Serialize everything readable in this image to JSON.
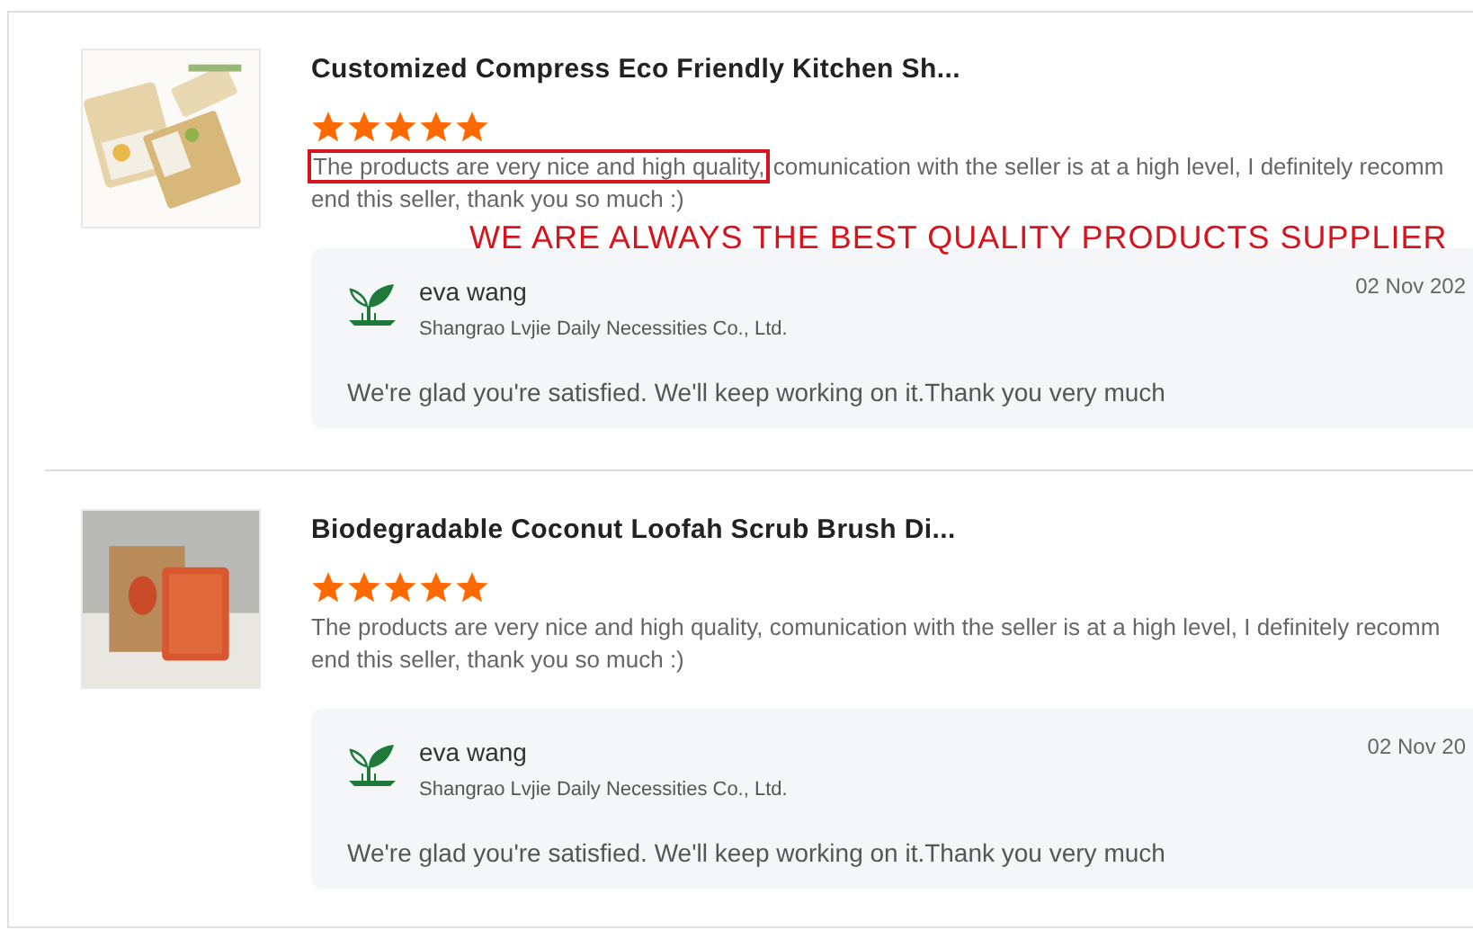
{
  "reviews": [
    {
      "kind": "picture",
      "title": "Customized Compress Eco Friendly Kitchen Sh...",
      "stars": 5,
      "comment": [
        {
          "text": "The products are very nice and high quality,",
          "boxed": true
        },
        {
          "text": "comunication with the seller is at a high level, I definitely recommend this seller, thank you so much :)",
          "boxed": false
        }
      ],
      "banner": "WE ARE ALWAYS THE BEST QUALITY PRODUCTS SUPPLIER",
      "reply": {
        "name": "eva wang",
        "company": "Shangrao Lvjie Daily Necessities Co., Ltd.",
        "date": "02 Nov 202",
        "text": "We're glad you're satisfied. We'll keep working on it.Thank you very much"
      }
    },
    {
      "kind": "picture",
      "title": "Biodegradable Coconut Loofah Scrub Brush Di...",
      "stars": 5,
      "comment": [
        {
          "text": "The products are very nice and high quality, comunication with the seller is at a high level, I definitely recommend this seller, thank you so much :)",
          "boxed": false
        }
      ],
      "reply": {
        "name": "eva wang",
        "company": "Shangrao Lvjie Daily Necessities Co., Ltd.",
        "date": "02 Nov 20",
        "text": "We're glad you're satisfied. We'll keep working on it.Thank you very much"
      }
    }
  ]
}
